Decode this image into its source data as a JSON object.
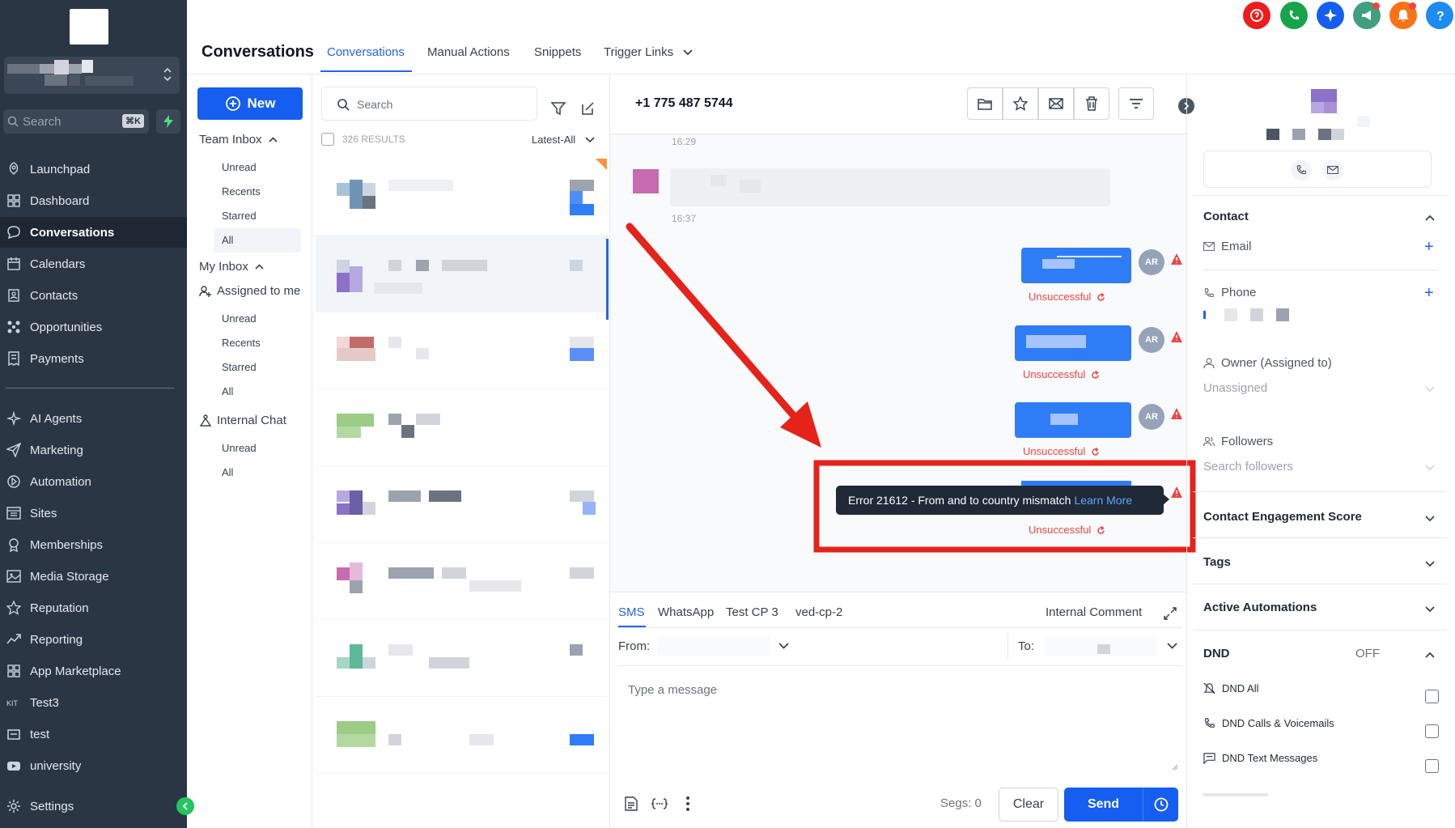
{
  "sidebar": {
    "search_label": "Search",
    "search_shortcut": "⌘K",
    "nav": [
      {
        "label": "Launchpad",
        "icon": "rocket-icon"
      },
      {
        "label": "Dashboard",
        "icon": "grid-icon"
      },
      {
        "label": "Conversations",
        "icon": "chat-bubble-icon",
        "active": true
      },
      {
        "label": "Calendars",
        "icon": "calendar-icon"
      },
      {
        "label": "Contacts",
        "icon": "contacts-icon"
      },
      {
        "label": "Opportunities",
        "icon": "pipeline-icon"
      },
      {
        "label": "Payments",
        "icon": "receipt-icon"
      },
      {
        "label": "AI Agents",
        "icon": "sparkle-icon"
      },
      {
        "label": "Marketing",
        "icon": "send-icon"
      },
      {
        "label": "Automation",
        "icon": "automation-icon"
      },
      {
        "label": "Sites",
        "icon": "browser-icon"
      },
      {
        "label": "Memberships",
        "icon": "award-icon"
      },
      {
        "label": "Media Storage",
        "icon": "image-icon"
      },
      {
        "label": "Reputation",
        "icon": "star-icon"
      },
      {
        "label": "Reporting",
        "icon": "trend-icon"
      },
      {
        "label": "App Marketplace",
        "icon": "apps-icon"
      },
      {
        "label": "Test3",
        "icon": "custom-icon"
      },
      {
        "label": "test",
        "icon": "box-icon"
      },
      {
        "label": "university",
        "icon": "video-icon"
      },
      {
        "label": "Settings",
        "icon": "gear-icon"
      }
    ]
  },
  "header": {
    "title": "Conversations",
    "tabs": [
      "Conversations",
      "Manual Actions",
      "Snippets",
      "Trigger Links"
    ],
    "top_icons": [
      {
        "name": "help-badge-icon",
        "color": "#ef1c1c"
      },
      {
        "name": "phone-call-icon",
        "color": "#16a34a"
      },
      {
        "name": "ai-sparkle-icon",
        "color": "#155eef"
      },
      {
        "name": "megaphone-icon",
        "color": "#3f9f7f"
      },
      {
        "name": "notification-bell-icon",
        "color": "#f97316"
      },
      {
        "name": "question-help-icon",
        "color": "#1d8cf0"
      }
    ]
  },
  "inbox": {
    "new_label": "New",
    "team_inbox": "Team Inbox",
    "team_items": [
      "Unread",
      "Recents",
      "Starred",
      "All"
    ],
    "my_inbox": "My Inbox",
    "assigned_to_me": "Assigned to me",
    "my_items": [
      "Unread",
      "Recents",
      "Starred",
      "All"
    ],
    "internal_chat": "Internal Chat",
    "internal_items": [
      "Unread",
      "All"
    ]
  },
  "list": {
    "search_placeholder": "Search",
    "results": "326 RESULTS",
    "sort": "Latest-All"
  },
  "chat": {
    "phone": "+1 775 487 5744",
    "time_1": "16:29",
    "time_2": "16:37",
    "avatar": "AR",
    "status": "Unsuccessful",
    "error_text": "Error 21612 - From and to country mismatch",
    "error_link": "Learn More"
  },
  "composer": {
    "channels": [
      "SMS",
      "WhatsApp",
      "Test CP 3",
      "ved-cp-2"
    ],
    "internal_comment": "Internal Comment",
    "from_label": "From:",
    "to_label": "To:",
    "placeholder": "Type a message",
    "segs": "Segs: 0",
    "clear": "Clear",
    "send": "Send"
  },
  "right_panel": {
    "contact_section": "Contact",
    "email_label": "Email",
    "phone_label": "Phone",
    "owner_label": "Owner (Assigned to)",
    "owner_value": "Unassigned",
    "followers_label": "Followers",
    "followers_placeholder": "Search followers",
    "engagement": "Contact Engagement Score",
    "tags": "Tags",
    "automations": "Active Automations",
    "dnd": "DND",
    "dnd_state": "OFF",
    "dnd_all": "DND All",
    "dnd_calls": "DND Calls & Voicemails",
    "dnd_text": "DND Text Messages"
  },
  "colors": {
    "primary": "#155eef",
    "sidebar": "#2b3645",
    "error": "#ef4444",
    "annotation": "#e5231b"
  }
}
